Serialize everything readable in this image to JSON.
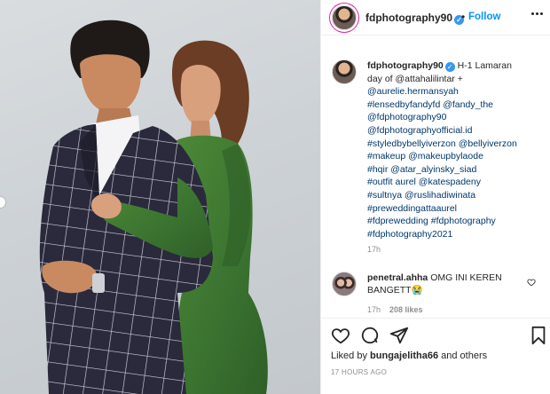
{
  "post": {
    "username": "fdphotography90",
    "follow_label": "Follow",
    "separator": "•"
  },
  "caption": {
    "username": "fdphotography90",
    "lines": [
      "H-1 Lamaran",
      "day of @attahalilintar +",
      "@aurelie.hermansyah",
      "#lensedbyfandyfd @fandy_the",
      "@fdphotography90",
      "@fdphotographyofficial.id",
      "#styledbybellyiverzon @bellyiverzon",
      "#makeup @makeupbylaode",
      "#hqir @atar_alyinsky_siad",
      "#outfit aurel @katespadeny",
      "#sultnya @ruslihadiwinata",
      "#preweddingattaaurel",
      "#fdprewedding #fdphotography",
      "#fdphotography2021"
    ],
    "time": "17h"
  },
  "comment": {
    "username": "penetral.ahha",
    "text": "OMG INI KEREN BANGETT",
    "emoji": "😭",
    "time": "17h",
    "likes": "208 likes"
  },
  "footer": {
    "liked_prefix": "Liked by",
    "liked_user": "bungajelitha66",
    "liked_suffix": "and others",
    "timestamp": "17 HOURS AGO"
  },
  "icons": {
    "verified": "verified-badge-icon",
    "more": "more-options-icon",
    "heart": "heart-icon",
    "comment": "comment-icon",
    "share": "share-icon",
    "bookmark": "bookmark-icon"
  },
  "colors": {
    "link": "#0095f6",
    "verified": "#3897f0",
    "jacket": "#2c2b3a",
    "dress": "#3d7a2f"
  }
}
